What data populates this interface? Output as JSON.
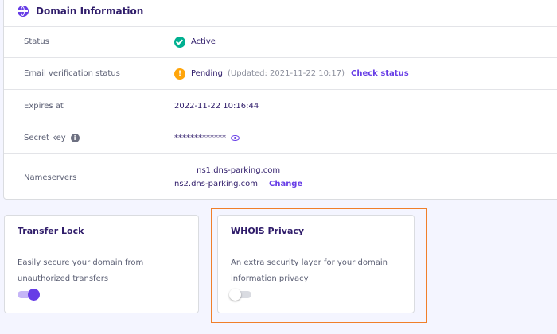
{
  "domain_info": {
    "title": "Domain Information",
    "rows": {
      "status": {
        "label": "Status",
        "value": "Active"
      },
      "email": {
        "label": "Email verification status",
        "value": "Pending",
        "updated": "(Updated: 2021-11-22 10:17)",
        "action": "Check status"
      },
      "expires": {
        "label": "Expires at",
        "value": "2022-11-22 10:16:44"
      },
      "secret": {
        "label": "Secret key",
        "value": "*************"
      },
      "nameservers": {
        "label": "Nameservers",
        "ns1": "ns1.dns-parking.com",
        "ns2": "ns2.dns-parking.com",
        "action": "Change"
      }
    }
  },
  "transfer_lock": {
    "title": "Transfer Lock",
    "description": "Easily secure your domain from unauthorized transfers",
    "enabled": true
  },
  "whois_privacy": {
    "title": "WHOIS Privacy",
    "description": "An extra security layer for your domain information privacy",
    "enabled": false
  },
  "colors": {
    "accent": "#673de6",
    "success": "#00b090",
    "warning": "#ffa50a",
    "highlight": "#f07f2a",
    "text_dark": "#2f1c6a"
  },
  "icons": {
    "header": "globe-icon",
    "status": "check-circle-icon",
    "pending": "warning-icon",
    "secret_info": "info-icon",
    "reveal": "eye-icon"
  }
}
